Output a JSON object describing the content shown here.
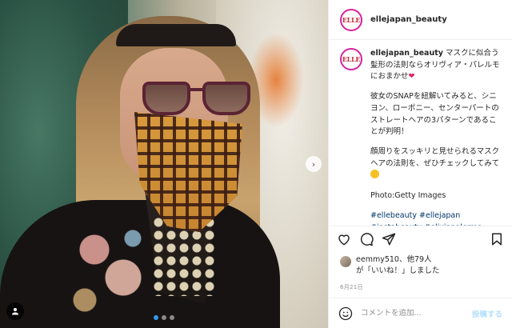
{
  "account": {
    "username": "ellejapan_beauty",
    "avatar_text": "ELLE"
  },
  "caption": {
    "username": "ellejapan_beauty",
    "line1": "マスクに似合う髪形の法則ならオリヴィア・パレルモにおまかせ",
    "line2": "彼女のSNAPを紐解いてみると、シニヨン、ローポニー、センターパートのストレートヘアの3パターンであることが判明！",
    "line3": "顔周りをスッキリと見せられるマスクヘアの法則を、ぜひチェックしてみて",
    "credit": "Photo:Getty Images",
    "hashtags": "#ellebeauty #ellejapan #instabeauty #oliviapalermo #oliviapalermostyle #scarfaddict #scarfstyle #scarf"
  },
  "likes": {
    "text_line1": "eemmy510、他79人",
    "text_line2": "が「いいね！」しました"
  },
  "date": "6月21日",
  "comment": {
    "placeholder": "コメントを追加...",
    "post_label": "投稿する"
  },
  "icons": {
    "heart": "heart-icon",
    "comment": "comment-icon",
    "share": "share-icon",
    "save": "bookmark-icon",
    "emoji": "emoji-icon",
    "next": "chevron-right-icon",
    "tag": "user-tag-icon"
  },
  "colors": {
    "accent_blue": "#3897f0",
    "post_button_disabled": "#b2dffc",
    "elle_red": "#c12f3b"
  },
  "carousel": {
    "total_slides": 3,
    "active_slide": 1
  }
}
